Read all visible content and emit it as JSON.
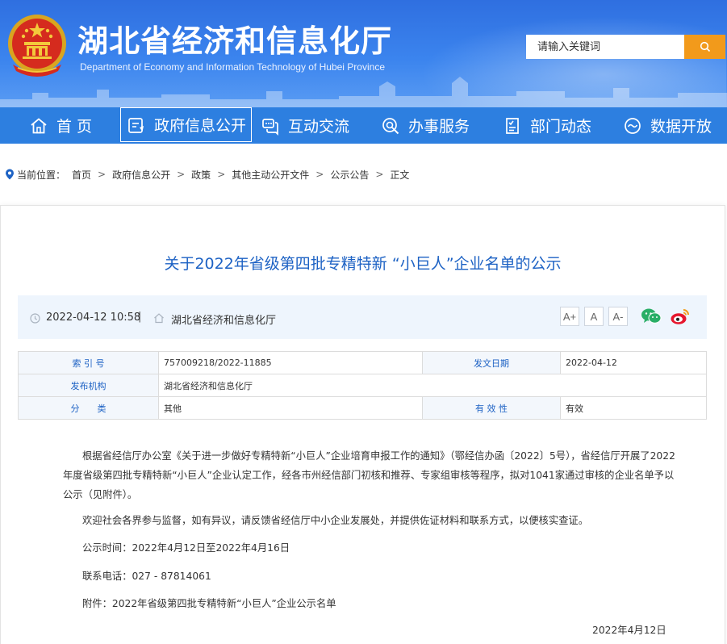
{
  "header": {
    "title": "湖北省经济和信息化厅",
    "subtitle": "Department of Economy and Information Technology of Hubei Province",
    "search_placeholder": "请输入关键词"
  },
  "nav": [
    {
      "label": "首 页",
      "icon": "home-icon"
    },
    {
      "label": "政府信息公开",
      "icon": "info-disclosure-icon",
      "active": true
    },
    {
      "label": "互动交流",
      "icon": "chat-icon"
    },
    {
      "label": "办事服务",
      "icon": "service-search-icon"
    },
    {
      "label": "部门动态",
      "icon": "news-icon"
    },
    {
      "label": "数据开放",
      "icon": "data-icon"
    }
  ],
  "breadcrumb": {
    "prefix": "当前位置：",
    "items": [
      "首页",
      "政府信息公开",
      "政策",
      "其他主动公开文件",
      "公示公告",
      "正文"
    ],
    "separator": ">"
  },
  "article": {
    "title": "关于2022年省级第四批专精特新 “小巨人”企业名单的公示",
    "date": "2022-04-12 10:58",
    "divider": "|",
    "source": "湖北省经济和信息化厅",
    "font_sizes": [
      "A+",
      "A",
      "A-"
    ]
  },
  "info_table": {
    "index_label": "索 引 号",
    "index_value": "757009218/2022-11885",
    "date_label": "发文日期",
    "date_value": "2022-04-12",
    "org_label": "发布机构",
    "org_value": "湖北省经济和信息化厅",
    "category_label": "分　　类",
    "category_value": "其他",
    "validity_label": "有 效 性",
    "validity_value": "有效"
  },
  "body": {
    "p1": "根据省经信厅办公室《关于进一步做好专精特新“小巨人”企业培育申报工作的通知》（鄂经信办函〔2022〕5号），省经信厅开展了2022年度省级第四批专精特新“小巨人”企业认定工作，经各市州经信部门初核和推荐、专家组审核等程序，拟对1041家通过审核的企业名单予以公示（见附件）。",
    "p2": "欢迎社会各界参与监督，如有异议，请反馈省经信厅中小企业发展处，并提供佐证材料和联系方式，以便核实查证。",
    "p3": "公示时间：2022年4月12日至2022年4月16日",
    "p4": "联系电话：027 - 87814061",
    "p5": "附件：2022年省级第四批专精特新“小巨人”企业公示名单",
    "sign_date": "2022年4月12日"
  },
  "colors": {
    "banner": "#3b84ee",
    "nav": "#2d7fe0",
    "search_button": "#f29a1b",
    "title_blue": "#1d62c4",
    "meta_bg": "#eef5fd",
    "wechat": "#2aae67",
    "weibo": "#e6162d"
  }
}
